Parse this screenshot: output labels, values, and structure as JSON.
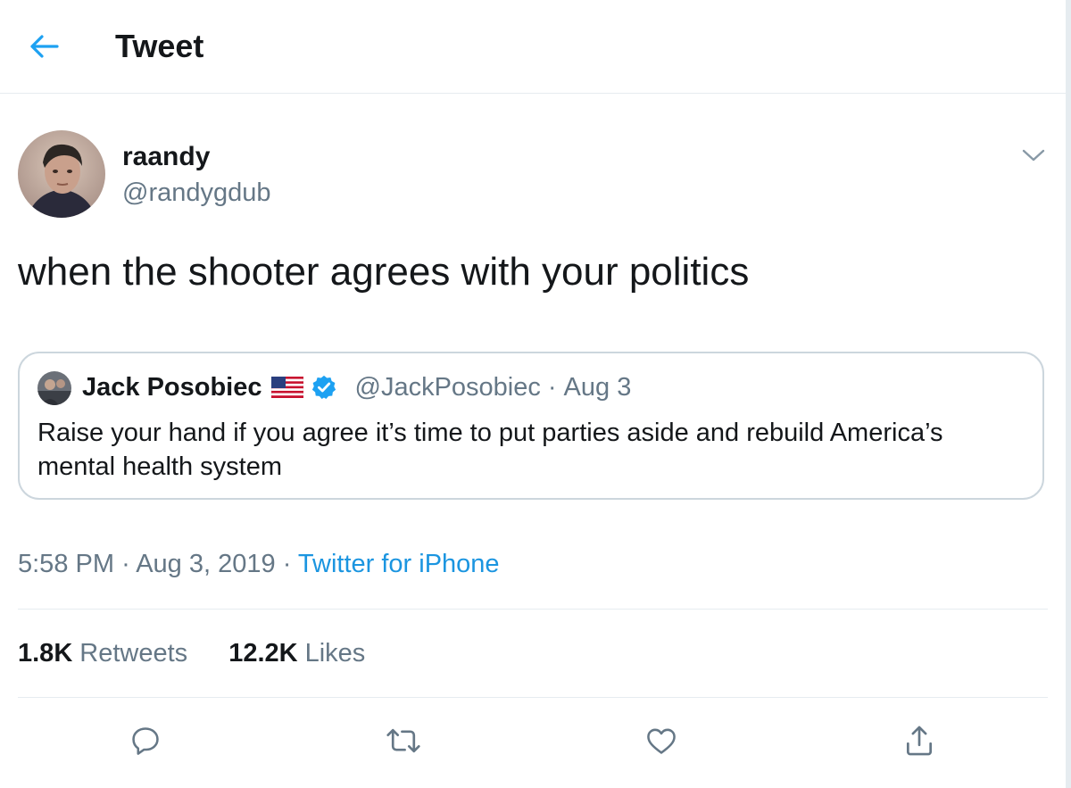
{
  "header": {
    "title": "Tweet"
  },
  "tweet": {
    "author_name": "raandy",
    "author_handle": "@randygdub",
    "text": "when the shooter agrees with your politics",
    "time": "5:58 PM",
    "date": "Aug 3, 2019",
    "separator": "·",
    "source": "Twitter for iPhone"
  },
  "quote": {
    "author_name": "Jack Posobiec",
    "author_handle": "@JackPosobiec",
    "separator": "·",
    "date": "Aug 3",
    "text": "Raise your hand if you agree it’s time to put parties aside and rebuild America’s mental health system"
  },
  "stats": {
    "retweets_count": "1.8K",
    "retweets_label": "Retweets",
    "likes_count": "12.2K",
    "likes_label": "Likes"
  },
  "icons": {
    "back": "arrow-left-icon",
    "more": "chevron-down-icon",
    "reply": "reply-icon",
    "retweet": "retweet-icon",
    "like": "heart-icon",
    "share": "share-icon",
    "verified": "verified-badge-icon",
    "flag": "us-flag-icon"
  },
  "colors": {
    "accent": "#1da1f2",
    "link": "#1b95e0",
    "text_primary": "#14171a",
    "text_secondary": "#657786",
    "border": "#e6ecf0",
    "quote_border": "#ccd6dd"
  }
}
